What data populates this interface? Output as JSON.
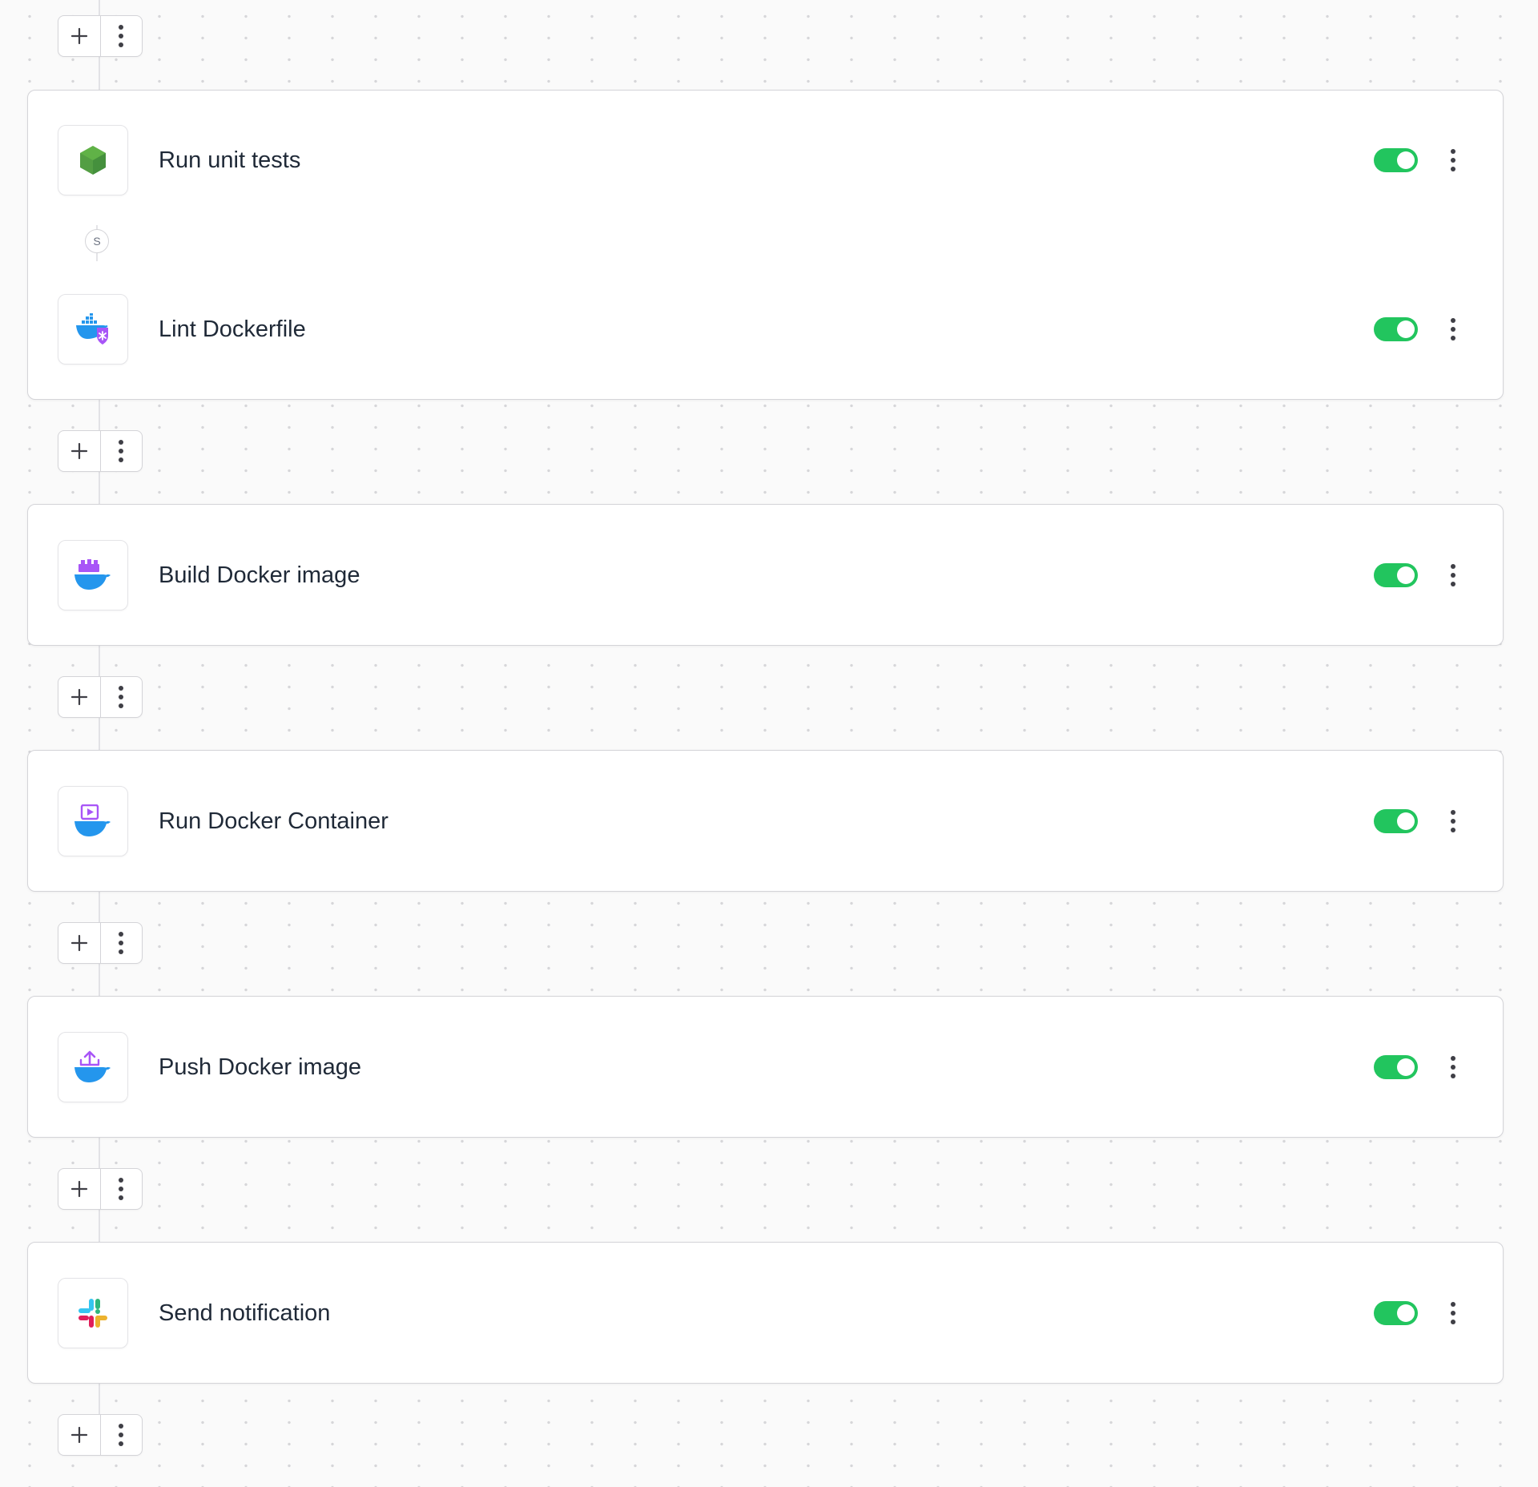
{
  "colors": {
    "toggle_on": "#22c55e",
    "border": "#d4d4d8",
    "text": "#1f2937",
    "icon_gray": "#3f3f46"
  },
  "toolbar_icons": {
    "add": "plus-icon",
    "more": "vertical-dots-icon"
  },
  "group1": {
    "steps": [
      {
        "title": "Run unit tests",
        "icon": "nodejs-hexagon-icon",
        "enabled": true
      },
      {
        "title": "Lint Dockerfile",
        "icon": "docker-lint-icon",
        "enabled": true
      }
    ],
    "mode_badge": "S"
  },
  "step_build": {
    "title": "Build Docker image",
    "icon": "docker-build-icon",
    "enabled": true
  },
  "step_run": {
    "title": "Run Docker Container",
    "icon": "docker-run-icon",
    "enabled": true
  },
  "step_push": {
    "title": "Push Docker image",
    "icon": "docker-push-icon",
    "enabled": true
  },
  "step_notify": {
    "title": "Send notification",
    "icon": "slack-icon",
    "enabled": true
  }
}
